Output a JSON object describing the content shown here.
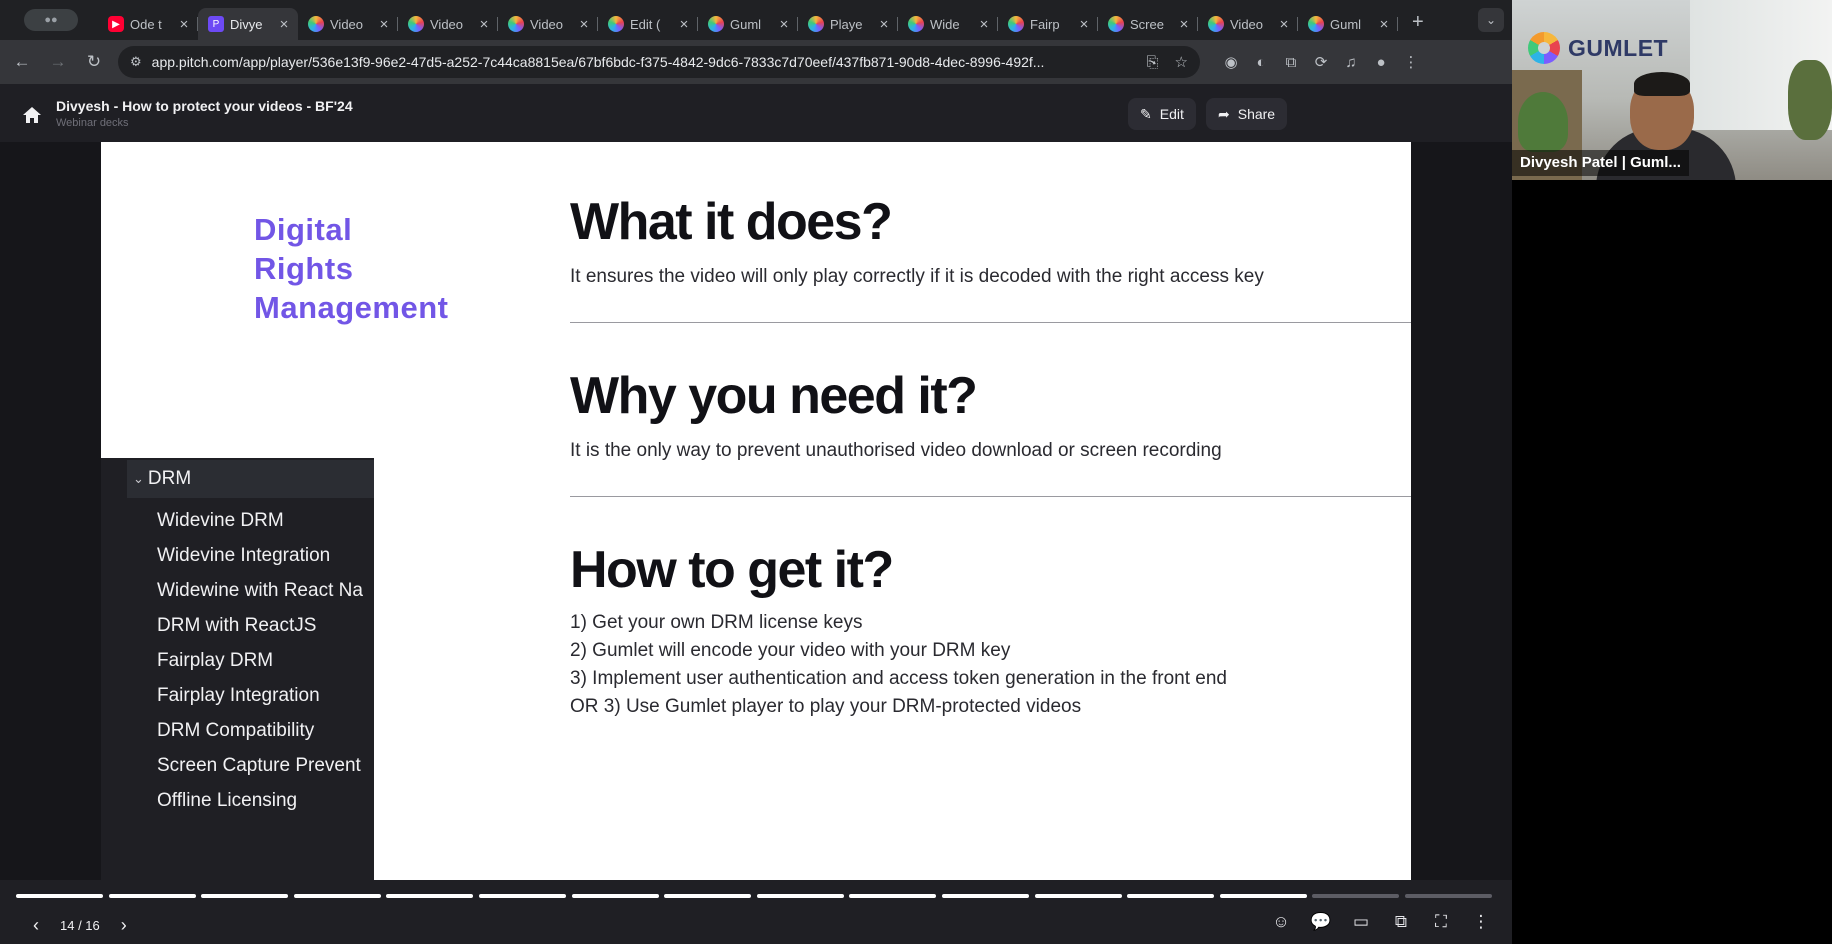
{
  "browser": {
    "tab_group_label": "",
    "tabs": [
      {
        "title": "Ode t",
        "favicon": "youtube-icon"
      },
      {
        "title": "Divye",
        "favicon": "pitch-icon",
        "active": true
      },
      {
        "title": "Video",
        "favicon": "gumlet-icon"
      },
      {
        "title": "Video",
        "favicon": "gumlet-icon"
      },
      {
        "title": "Video",
        "favicon": "gumlet-icon"
      },
      {
        "title": "Edit (",
        "favicon": "gumlet-icon"
      },
      {
        "title": "Guml",
        "favicon": "gumlet-icon"
      },
      {
        "title": "Playe",
        "favicon": "gumlet-icon"
      },
      {
        "title": "Wide",
        "favicon": "gumlet-icon"
      },
      {
        "title": "Fairp",
        "favicon": "gumlet-icon"
      },
      {
        "title": "Scree",
        "favicon": "gumlet-icon"
      },
      {
        "title": "Video",
        "favicon": "gumlet-icon"
      },
      {
        "title": "Guml",
        "favicon": "gumlet-icon"
      }
    ],
    "url": "app.pitch.com/app/player/536e13f9-96e2-47d5-a252-7c44ca8815ea/67bf6bdc-f375-4842-9dc6-7833c7d70eef/437fb871-90d8-4dec-8996-492f..."
  },
  "appbar": {
    "deck_title": "Divyesh - How to protect your videos - BF'24",
    "deck_subtitle": "Webinar decks",
    "edit_label": "Edit",
    "share_label": "Share"
  },
  "slide": {
    "side_title_lines": [
      "Digital",
      "Rights",
      "Management"
    ],
    "sections": [
      {
        "heading": "What it does?",
        "body": "It ensures the video will only play correctly if it is decoded with the right access key"
      },
      {
        "heading": "Why you need it?",
        "body": "It is the only way to prevent unauthorised video download or screen recording"
      },
      {
        "heading": "How to get it?"
      }
    ],
    "steps": [
      "1) Get your own DRM license keys",
      "2) Gumlet will encode your video with your DRM key",
      "3) Implement user authentication and access token generation in the front end",
      "OR 3) Use Gumlet player to play your DRM-protected videos"
    ],
    "brand_color": "#7256e6"
  },
  "sidebar": {
    "header": "DRM",
    "items": [
      "Widevine DRM",
      "Widevine Integration",
      "Widewine with React Na",
      "DRM with ReactJS",
      "Fairplay DRM",
      "Fairplay Integration",
      "DRM Compatibility",
      "Screen Capture Prevent",
      "Offline Licensing"
    ]
  },
  "player": {
    "page_indicator": "14 / 16",
    "current_page": 14,
    "total_pages": 16
  },
  "webcam": {
    "logo_text": "GUMLET",
    "participant_name": "Divyesh Patel | Guml..."
  }
}
